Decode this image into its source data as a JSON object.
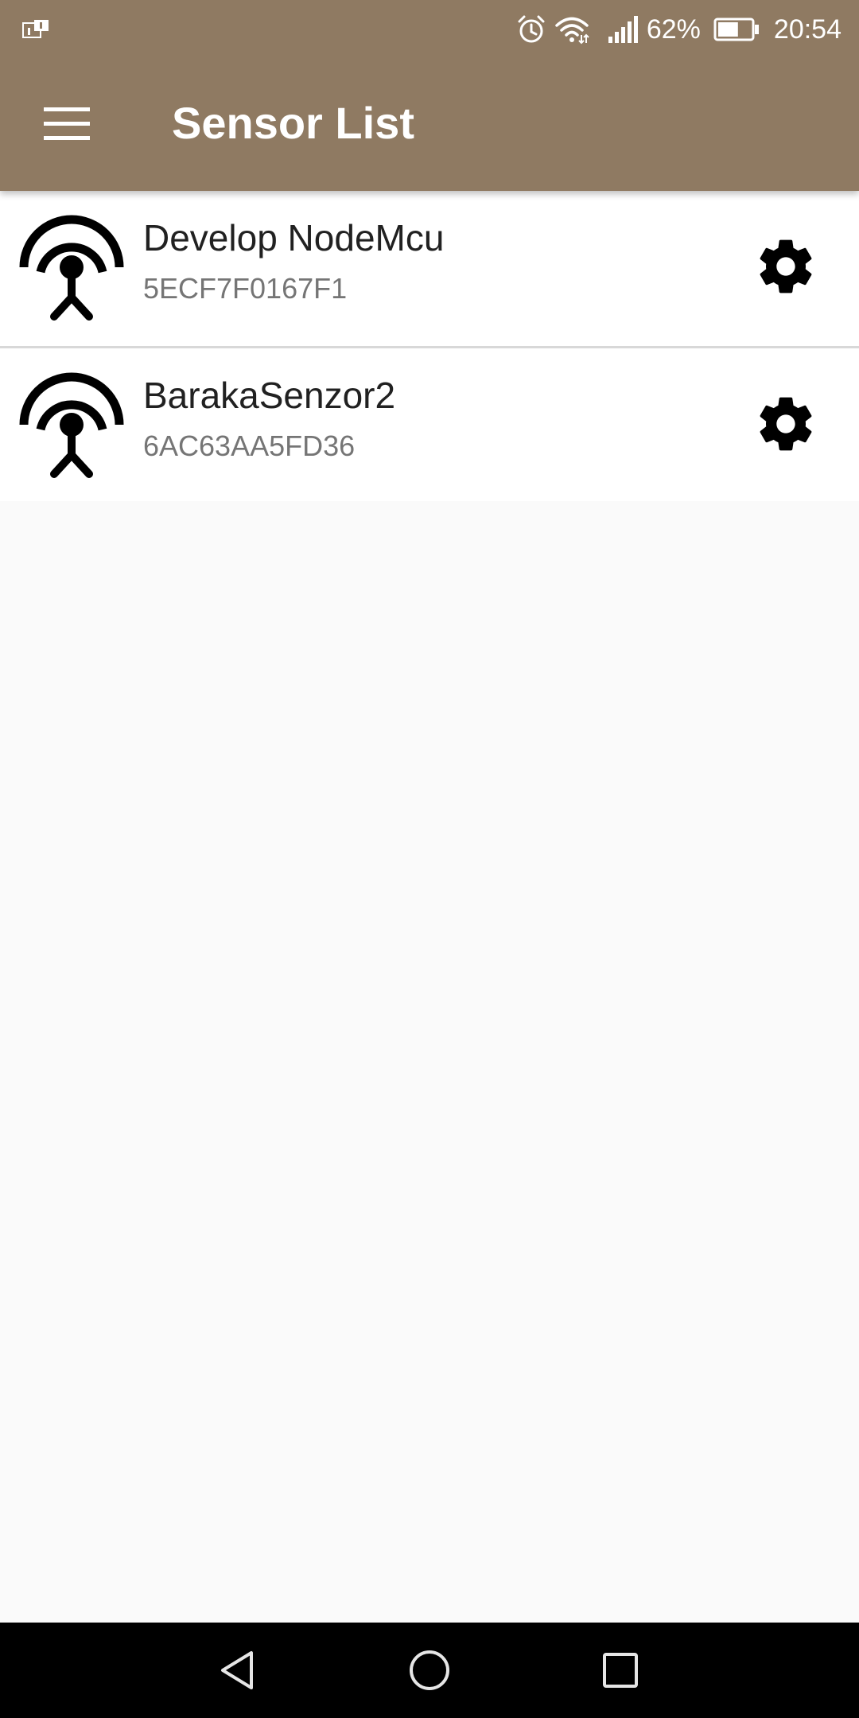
{
  "status_bar": {
    "battery_percent": "62%",
    "time": "20:54",
    "battery_level": 0.62,
    "icons": [
      "sim-notification-icon",
      "alarm-icon",
      "wifi-icon",
      "signal-icon",
      "battery-icon"
    ]
  },
  "toolbar": {
    "title": "Sensor List",
    "menu_icon": "hamburger-menu-icon",
    "background_color": "#8f7a62"
  },
  "sensors": [
    {
      "name": "Develop NodeMcu",
      "id": "5ECF7F0167F1",
      "icon": "antenna-icon",
      "action_icon": "gear-icon"
    },
    {
      "name": "BarakaSenzor2",
      "id": "6AC63AA5FD36",
      "icon": "antenna-icon",
      "action_icon": "gear-icon"
    }
  ],
  "nav_bar": {
    "icons": [
      "back-icon",
      "home-icon",
      "recents-icon"
    ]
  }
}
